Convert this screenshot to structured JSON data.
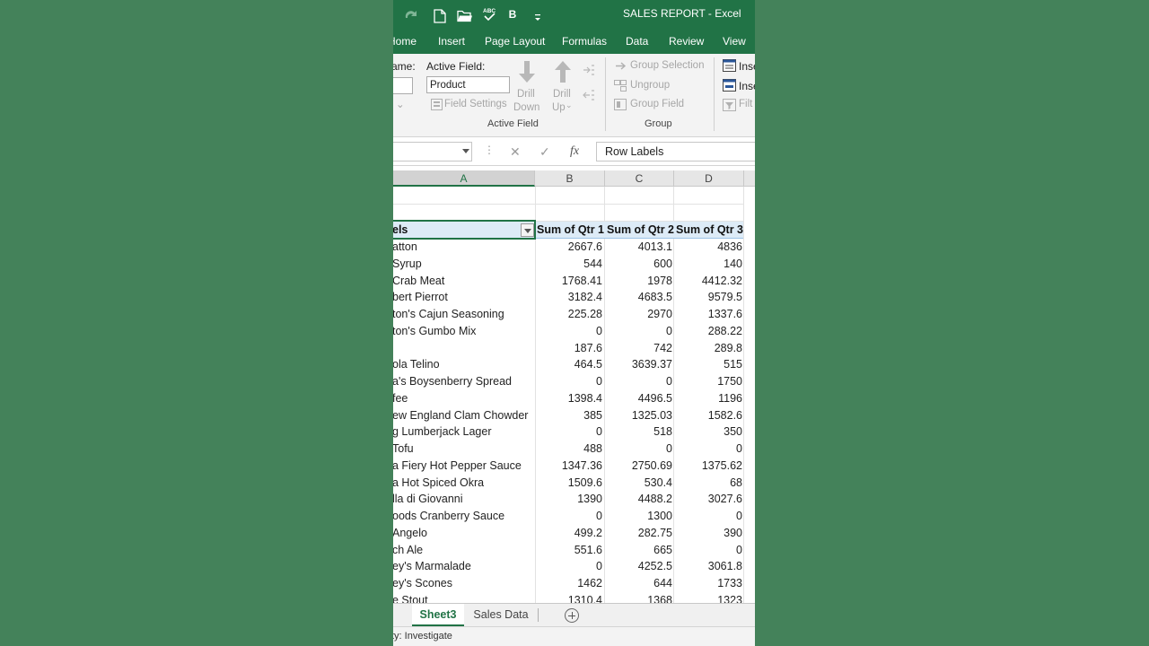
{
  "titlebar": {
    "title": "SALES REPORT  -  Excel",
    "bold_label": "B"
  },
  "tabs": [
    "Home",
    "Insert",
    "Page Layout",
    "Formulas",
    "Data",
    "Review",
    "View"
  ],
  "ribbon": {
    "name_label": "ame:",
    "active_field_label": "Active Field:",
    "active_field_value": "Product",
    "field_settings": "Field Settings",
    "drill_down_1": "Drill",
    "drill_down_2": "Down",
    "drill_up_1": "Drill",
    "drill_up_2": "Up",
    "group_active_field": "Active Field",
    "group_selection": "Group Selection",
    "ungroup": "Ungroup",
    "group_field": "Group Field",
    "group_group": "Group",
    "insert_1": "Inse",
    "insert_2": "Inse",
    "filter": "Filt"
  },
  "formula_bar": {
    "content": "Row Labels",
    "fx": "fx"
  },
  "columns": [
    "A",
    "B",
    "C",
    "D"
  ],
  "pivot": {
    "header": [
      "els",
      "Sum of Qtr 1",
      "Sum of Qtr 2",
      "Sum of Qtr 3"
    ],
    "rows": [
      [
        "atton",
        "2667.6",
        "4013.1",
        "4836"
      ],
      [
        "Syrup",
        "544",
        "600",
        "140"
      ],
      [
        "Crab Meat",
        "1768.41",
        "1978",
        "4412.32"
      ],
      [
        "bert Pierrot",
        "3182.4",
        "4683.5",
        "9579.5"
      ],
      [
        "ton's Cajun Seasoning",
        "225.28",
        "2970",
        "1337.6"
      ],
      [
        "ton's Gumbo Mix",
        "0",
        "0",
        "288.22"
      ],
      [
        "",
        "187.6",
        "742",
        "289.8"
      ],
      [
        "ola Telino",
        "464.5",
        "3639.37",
        "515"
      ],
      [
        "a's Boysenberry Spread",
        "0",
        "0",
        "1750"
      ],
      [
        "fee",
        "1398.4",
        "4496.5",
        "1196"
      ],
      [
        "ew England Clam Chowder",
        "385",
        "1325.03",
        "1582.6"
      ],
      [
        "g Lumberjack Lager",
        "0",
        "518",
        "350"
      ],
      [
        "Tofu",
        "488",
        "0",
        "0"
      ],
      [
        "a Fiery Hot Pepper Sauce",
        "1347.36",
        "2750.69",
        "1375.62"
      ],
      [
        "a Hot Spiced Okra",
        "1509.6",
        "530.4",
        "68"
      ],
      [
        "lla di Giovanni",
        "1390",
        "4488.2",
        "3027.6"
      ],
      [
        "oods Cranberry Sauce",
        "0",
        "1300",
        "0"
      ],
      [
        "Angelo",
        "499.2",
        "282.75",
        "390"
      ],
      [
        "ch Ale",
        "551.6",
        "665",
        "0"
      ],
      [
        "ey's Marmalade",
        "0",
        "4252.5",
        "3061.8"
      ],
      [
        "ey's Scones",
        "1462",
        "644",
        "1733"
      ],
      [
        "e Stout",
        "1310.4",
        "1368",
        "1323"
      ]
    ]
  },
  "sheets": [
    "Sheet3",
    "Sales Data"
  ],
  "status": {
    "text": "ty: Investigate"
  },
  "colors": {
    "excel_green": "#217346",
    "background": "#44825a",
    "pivot_header": "#ddebf7"
  }
}
